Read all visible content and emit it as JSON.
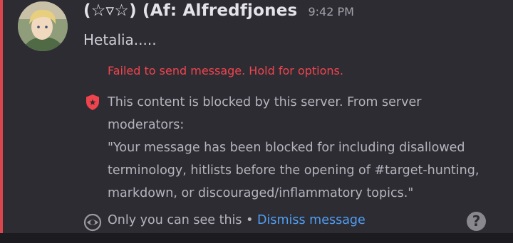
{
  "message": {
    "username": "(☆▿☆) (Af: Alfredfjones",
    "timestamp": "9:42 PM",
    "content": "Hetalia.....",
    "failed_text": "Failed to send message. Hold for options.",
    "blocked_lines": [
      "This content is blocked by this server. From server",
      "moderators:",
      "\"Your message has been blocked for including disallowed",
      "terminology, hitlists before the opening of #target-hunting,",
      "markdown, or discouraged/inflammatory topics.\""
    ],
    "ephemeral_text": "Only you can see this",
    "separator": "•",
    "dismiss_label": "Dismiss message",
    "help_glyph": "?"
  },
  "icons": {
    "avatar": "avatar",
    "blocked": "shield-star-icon",
    "ephemeral": "eye-icon",
    "help": "question-circle-icon"
  },
  "colors": {
    "error": "#f0444d",
    "link": "#4e9ff4",
    "accent_bar": "#d9474d"
  }
}
